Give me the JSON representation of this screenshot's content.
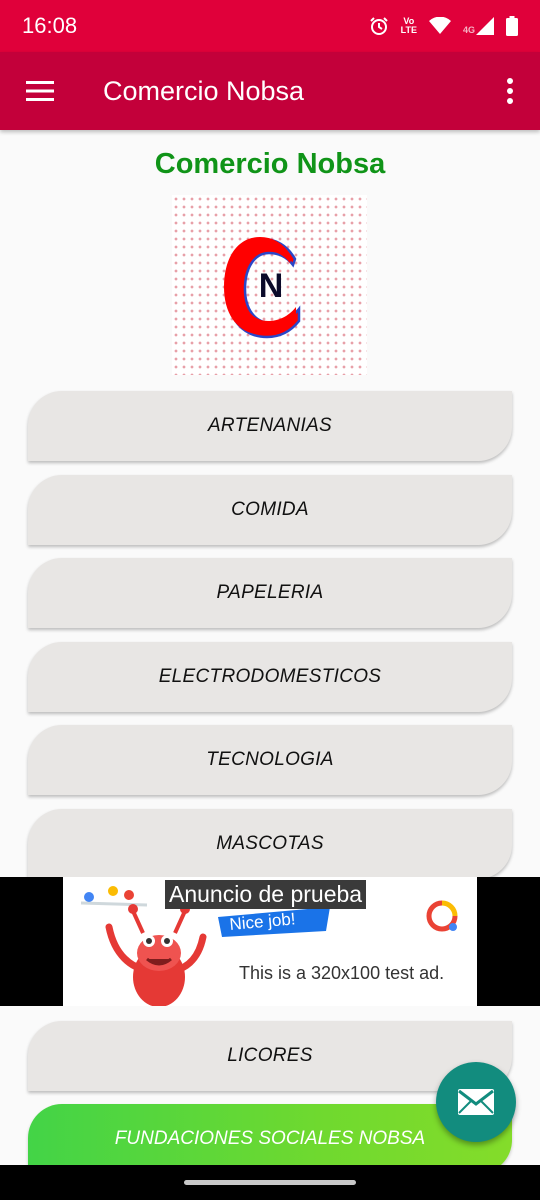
{
  "status_bar": {
    "time": "16:08",
    "volte_label_top": "Vo",
    "volte_label_bottom": "LTE",
    "network_label": "4G",
    "icons": [
      "alarm-icon",
      "volte-icon",
      "wifi-icon",
      "signal-icon",
      "battery-icon"
    ]
  },
  "app_bar": {
    "title": "Comercio Nobsa",
    "icons": [
      "menu-icon",
      "more-vert-icon"
    ]
  },
  "main": {
    "heading": "Comercio Nobsa",
    "logo_letters": "N",
    "categories": [
      {
        "label": "ARTENANIAS"
      },
      {
        "label": "COMIDA"
      },
      {
        "label": "PAPELERIA"
      },
      {
        "label": "ELECTRODOMESTICOS"
      },
      {
        "label": "TECNOLOGIA"
      },
      {
        "label": "MASCOTAS"
      }
    ],
    "categories_after_ad": [
      {
        "label": "LICORES"
      }
    ],
    "foundations_button": "FUNDACIONES SOCIALES NOBSA"
  },
  "ad": {
    "label": "Anuncio de prueba",
    "banner_text": "Nice job!",
    "text": "This is a 320x100 test ad."
  },
  "fab": {
    "icon": "mail-icon"
  },
  "colors": {
    "status_bar": "#e0003a",
    "app_bar": "#c3003a",
    "heading_green": "#109418",
    "button_gray": "#e8e6e4",
    "fab_teal": "#128c7e",
    "logo_red": "#ff0000"
  }
}
